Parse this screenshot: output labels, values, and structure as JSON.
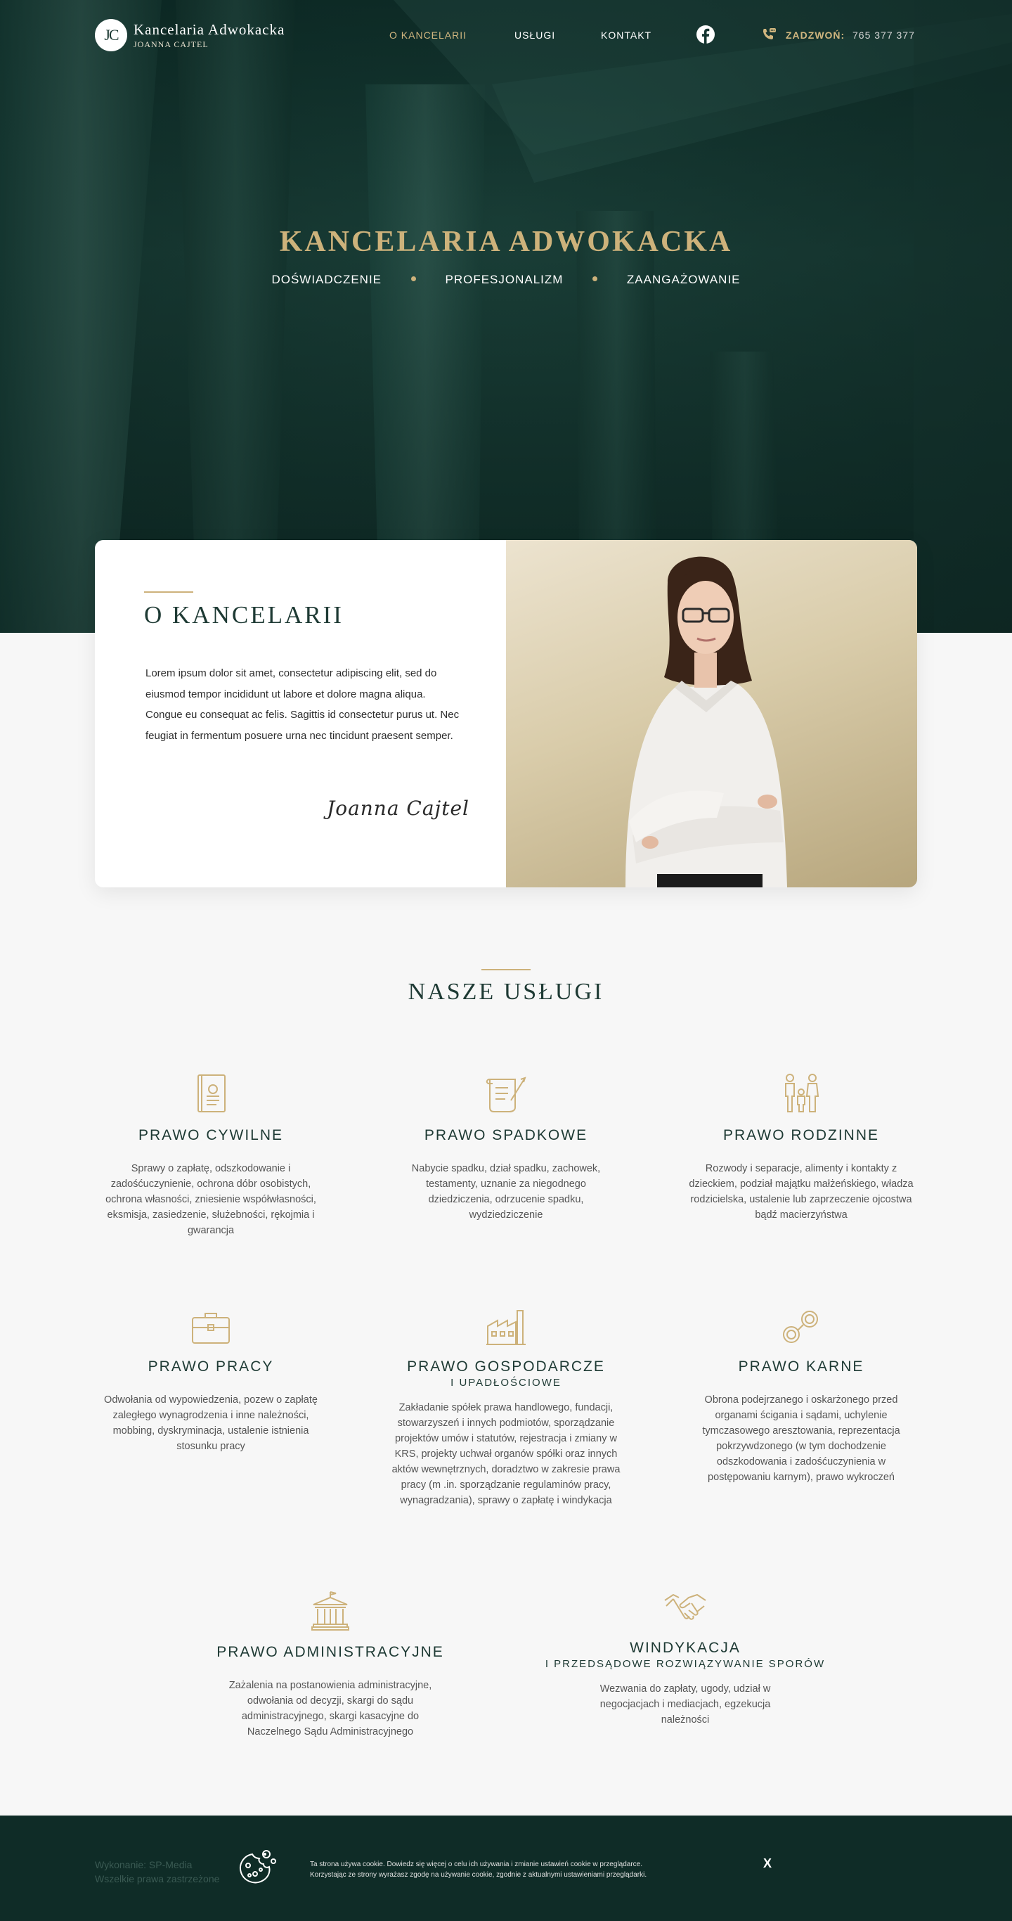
{
  "nav": {
    "logo_mark": "JC",
    "logo_title": "Kancelaria Adwokacka",
    "logo_subtitle": "JOANNA CAJTEL",
    "links": [
      {
        "label": "O KANCELARII",
        "active": true
      },
      {
        "label": "USŁUGI",
        "active": false
      },
      {
        "label": "KONTAKT",
        "active": false
      }
    ],
    "social_icon": "facebook-icon",
    "call_label": "ZADZWOŃ:",
    "call_number": "765 377 377"
  },
  "hero": {
    "title": "KANCELARIA ADWOKACKA",
    "tags": [
      "DOŚWIADCZENIE",
      "PROFESJONALIZM",
      "ZAANGAŻOWANIE"
    ]
  },
  "about": {
    "title": "O KANCELARII",
    "text": "Lorem ipsum dolor sit amet, consectetur adipiscing elit, sed do eiusmod tempor incididunt ut labore et dolore magna aliqua. Congue eu consequat ac felis. Sagittis id consectetur purus ut. Nec feugiat in fermentum posuere urna nec tincidunt praesent semper.",
    "signature": "Joanna Cajtel"
  },
  "services": {
    "title": "NASZE USŁUGI",
    "items": [
      {
        "icon": "law-book-icon",
        "title": "PRAWO CYWILNE",
        "subtitle": "",
        "text": "Sprawy o zapłatę, odszkodowanie i zadośćuczynienie, ochrona dóbr osobistych, ochrona własności, zniesienie współwłasności, eksmisja, zasiedzenie, służebności, rękojmia i gwarancja"
      },
      {
        "icon": "scroll-quill-icon",
        "title": "PRAWO SPADKOWE",
        "subtitle": "",
        "text": "Nabycie spadku, dział spadku, zachowek, testamenty, uznanie za niegodnego dziedziczenia, odrzucenie spadku, wydziedziczenie"
      },
      {
        "icon": "family-icon",
        "title": "PRAWO RODZINNE",
        "subtitle": "",
        "text": "Rozwody i separacje, alimenty i kontakty z dzieckiem, podział majątku małżeńskiego, władza rodzicielska, ustalenie lub zaprzeczenie ojcostwa bądź macierzyństwa"
      },
      {
        "icon": "briefcase-icon",
        "title": "PRAWO PRACY",
        "subtitle": "",
        "text": "Odwołania od wypowiedzenia, pozew o zapłatę zaległego wynagrodzenia i inne należności, mobbing, dyskryminacja, ustalenie istnienia stosunku pracy"
      },
      {
        "icon": "factory-icon",
        "title": "PRAWO GOSPODARCZE",
        "subtitle": "I UPADŁOŚCIOWE",
        "text": "Zakładanie spółek prawa handlowego, fundacji, stowarzyszeń i innych podmiotów, sporządzanie projektów umów i statutów, rejestracja i zmiany w KRS, projekty uchwał organów spółki oraz innych aktów wewnętrznych, doradztwo w zakresie prawa pracy (m .in. sporządzanie regulaminów pracy, wynagradzania), sprawy o zapłatę i windykacja"
      },
      {
        "icon": "handcuffs-icon",
        "title": "PRAWO KARNE",
        "subtitle": "",
        "text": "Obrona podejrzanego i oskarżonego przed organami ścigania i sądami, uchylenie tymczasowego aresztowania, reprezentacja pokrzywdzonego (w tym dochodzenie odszkodowania i zadośćuczynienia w postępowaniu karnym), prawo wykroczeń"
      },
      {
        "icon": "courthouse-icon",
        "title": "PRAWO ADMINISTRACYJNE",
        "subtitle": "",
        "text": "Zażalenia na postanowienia administracyjne, odwołania od decyzji, skargi do sądu administracyjnego, skargi kasacyjne do Naczelnego Sądu Administracyjnego"
      },
      {
        "icon": "handshake-icon",
        "title": "WINDYKACJA",
        "subtitle": "I PRZEDSĄDOWE ROZWIĄZYWANIE SPORÓW",
        "text": "Wezwania do zapłaty, ugody, udział w negocjacjach i mediacjach, egzekucja należności"
      }
    ]
  },
  "footer": {
    "credit_line1": "Wykonanie: SP-Media",
    "credit_line2": "Wszelkie prawa zastrzeżone",
    "cookie_icon": "cookie-icon",
    "cookie_text_line1": "Ta strona używa cookie. Dowiedz się więcej o celu ich używania i zmianie ustawień cookie w przeglądarce.",
    "cookie_text_line2": "Korzystając ze strony wyrażasz zgodę na używanie cookie, zgodnie z aktualnymi ustawieniami przeglądarki.",
    "cookie_close": "X"
  },
  "colors": {
    "gold": "#cdb27b",
    "dark_green": "#0f2c27",
    "text_green": "#1e3a34"
  }
}
